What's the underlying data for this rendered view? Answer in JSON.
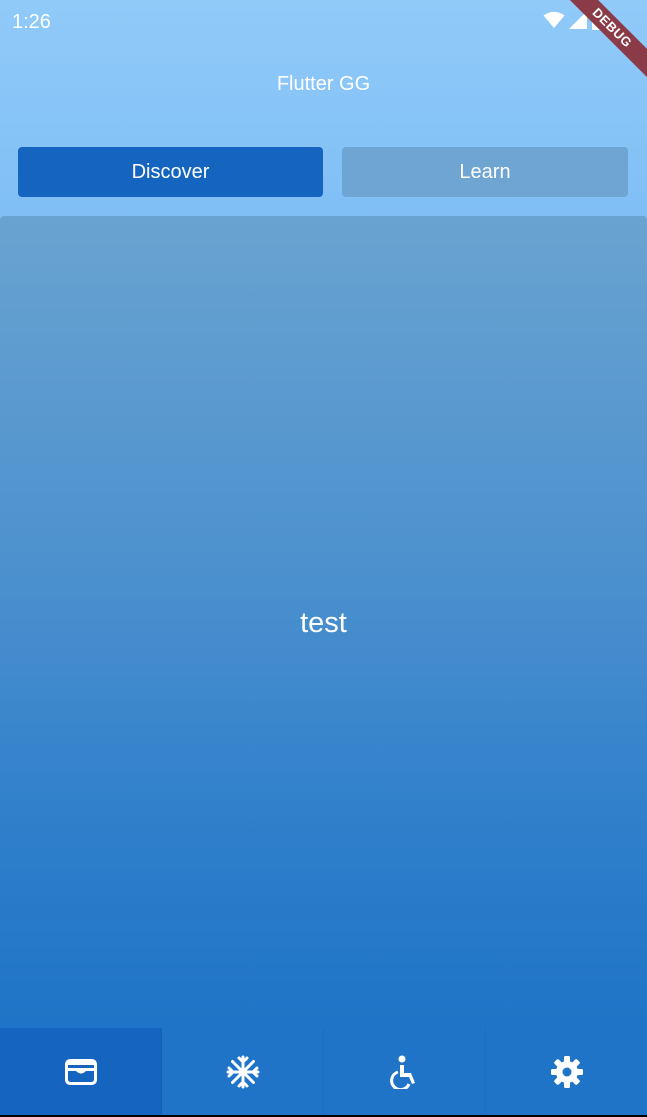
{
  "status_bar": {
    "time": "1:26",
    "icons": [
      "wifi-icon",
      "signal-icon",
      "battery-icon"
    ]
  },
  "debug_banner": "DEBUG",
  "app": {
    "title": "Flutter GG"
  },
  "segments": {
    "selected": "Discover",
    "items": [
      {
        "label": "Discover"
      },
      {
        "label": "Learn"
      }
    ]
  },
  "content": {
    "text": "test"
  },
  "bottom_nav": {
    "items": [
      {
        "icon": "wallet-icon"
      },
      {
        "icon": "snowflake-icon"
      },
      {
        "icon": "accessibility-icon"
      },
      {
        "icon": "settings-gear-icon"
      }
    ]
  },
  "colors": {
    "primary": "#1565c0",
    "inactive_segment": "#6ea5d2",
    "gradient_top": "#90caf9",
    "gradient_bottom": "#1f75c8",
    "debug_ribbon": "#8b3b47"
  }
}
